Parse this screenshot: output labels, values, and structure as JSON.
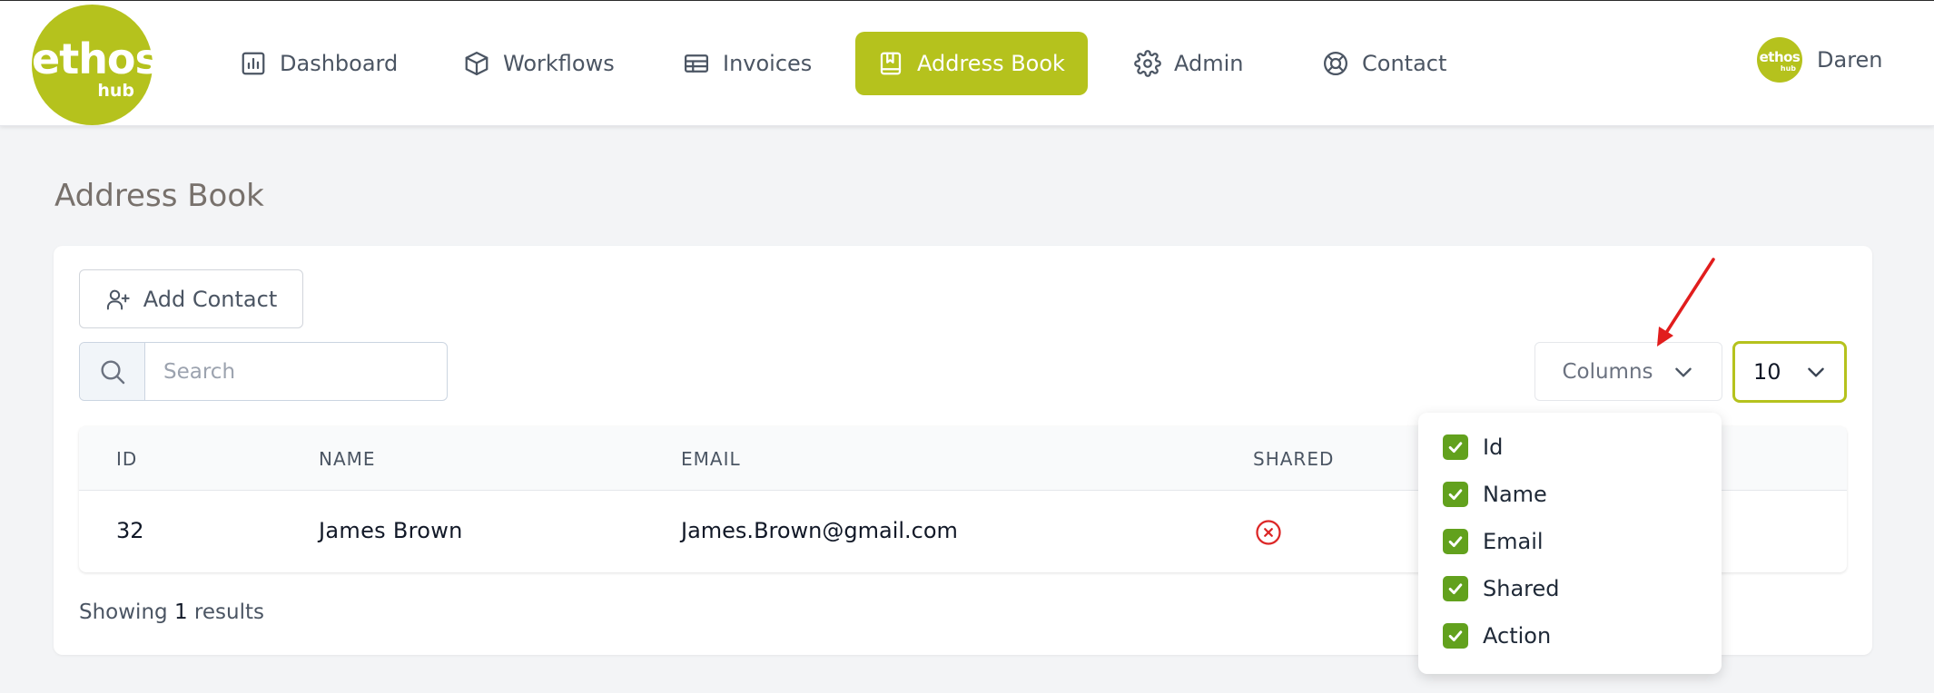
{
  "brand": {
    "logo_main": "ethos",
    "logo_sub": "hub",
    "accent_color": "#b5c21d"
  },
  "nav": {
    "items": [
      {
        "label": "Dashboard",
        "icon": "chart-icon"
      },
      {
        "label": "Workflows",
        "icon": "cube-icon"
      },
      {
        "label": "Invoices",
        "icon": "table-icon"
      },
      {
        "label": "Address Book",
        "icon": "bookmark-book-icon",
        "active": true
      },
      {
        "label": "Admin",
        "icon": "gear-icon"
      },
      {
        "label": "Contact",
        "icon": "lifebuoy-icon"
      }
    ]
  },
  "user": {
    "name": "Daren",
    "avatar_main": "ethos",
    "avatar_sub": "hub"
  },
  "page": {
    "title": "Address Book"
  },
  "toolbar": {
    "add_contact_label": "Add Contact",
    "search_placeholder": "Search",
    "search_value": "",
    "columns_label": "Columns",
    "per_page_value": "10"
  },
  "table": {
    "headers": [
      "ID",
      "NAME",
      "EMAIL",
      "SHARED"
    ],
    "rows": [
      {
        "id": "32",
        "name": "James Brown",
        "email": "James.Brown@gmail.com",
        "shared": false
      }
    ]
  },
  "footer": {
    "showing_prefix": "Showing",
    "count": "1",
    "showing_suffix": "results"
  },
  "columns_menu": {
    "items": [
      {
        "label": "Id",
        "checked": true
      },
      {
        "label": "Name",
        "checked": true
      },
      {
        "label": "Email",
        "checked": true
      },
      {
        "label": "Shared",
        "checked": true
      },
      {
        "label": "Action",
        "checked": true
      }
    ]
  },
  "colors": {
    "check": "#62a11d",
    "error": "#dc2626",
    "annotation_arrow": "#e11d1d"
  }
}
